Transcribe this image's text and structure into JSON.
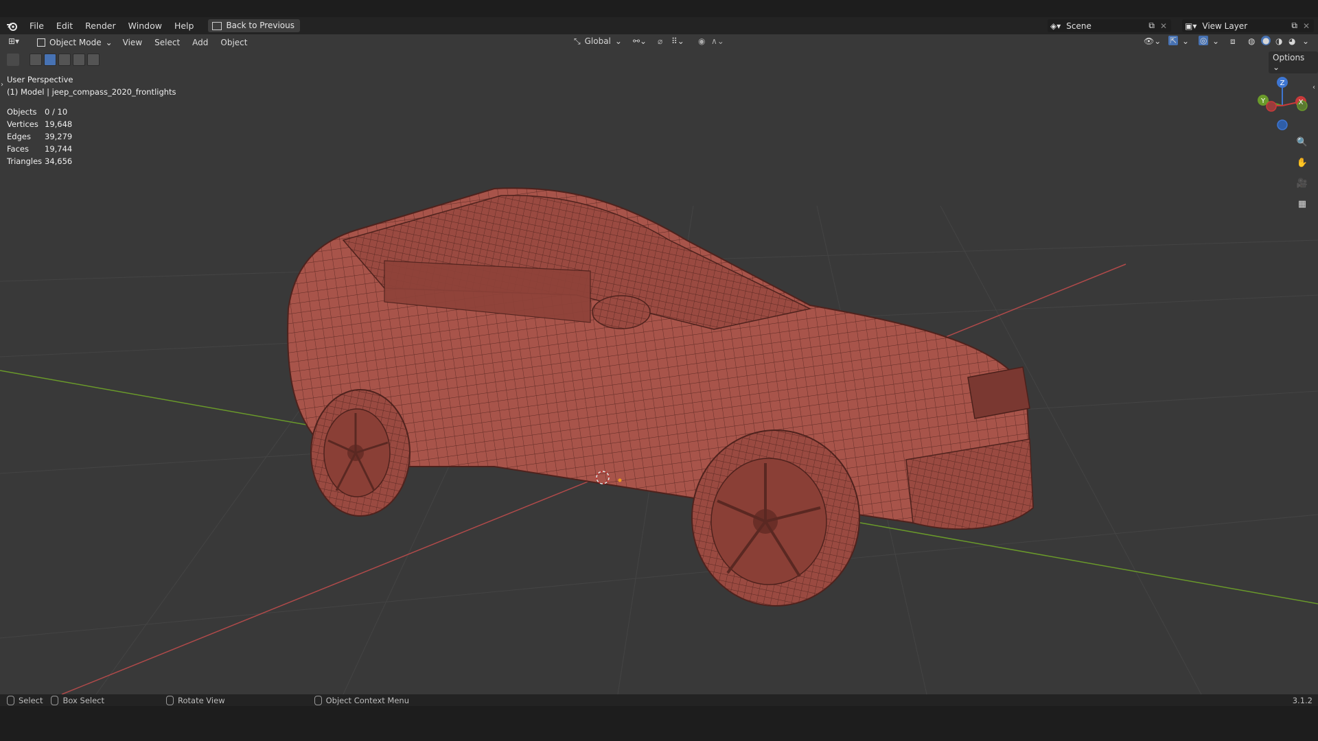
{
  "menubar": {
    "items": [
      "File",
      "Edit",
      "Render",
      "Window",
      "Help"
    ],
    "back_button": "Back to Previous",
    "scene_label": "Scene",
    "view_layer_label": "View Layer"
  },
  "viewport_header": {
    "mode_label": "Object Mode",
    "menus": [
      "View",
      "Select",
      "Add",
      "Object"
    ],
    "transform_orientation": "Global",
    "options_label": "Options"
  },
  "viewport": {
    "perspective_label": "User Perspective",
    "object_label": "(1) Model | jeep_compass_2020_frontlights",
    "stats": [
      {
        "label": "Objects",
        "value": "0 / 10"
      },
      {
        "label": "Vertices",
        "value": "19,648"
      },
      {
        "label": "Edges",
        "value": "39,279"
      },
      {
        "label": "Faces",
        "value": "19,744"
      },
      {
        "label": "Triangles",
        "value": "34,656"
      }
    ],
    "gizmo_axes": {
      "z": "Z",
      "y": "Y",
      "x": "X"
    }
  },
  "statusbar": {
    "select": "Select",
    "box_select": "Box Select",
    "rotate_view": "Rotate View",
    "context_menu": "Object Context Menu",
    "version": "3.1.2"
  },
  "colors": {
    "viewport_bg": "#393939",
    "model_fill": "#a8544a",
    "wire": "#5e2a24",
    "x_axis": "#b04a4a",
    "y_axis": "#6a9a2a"
  }
}
